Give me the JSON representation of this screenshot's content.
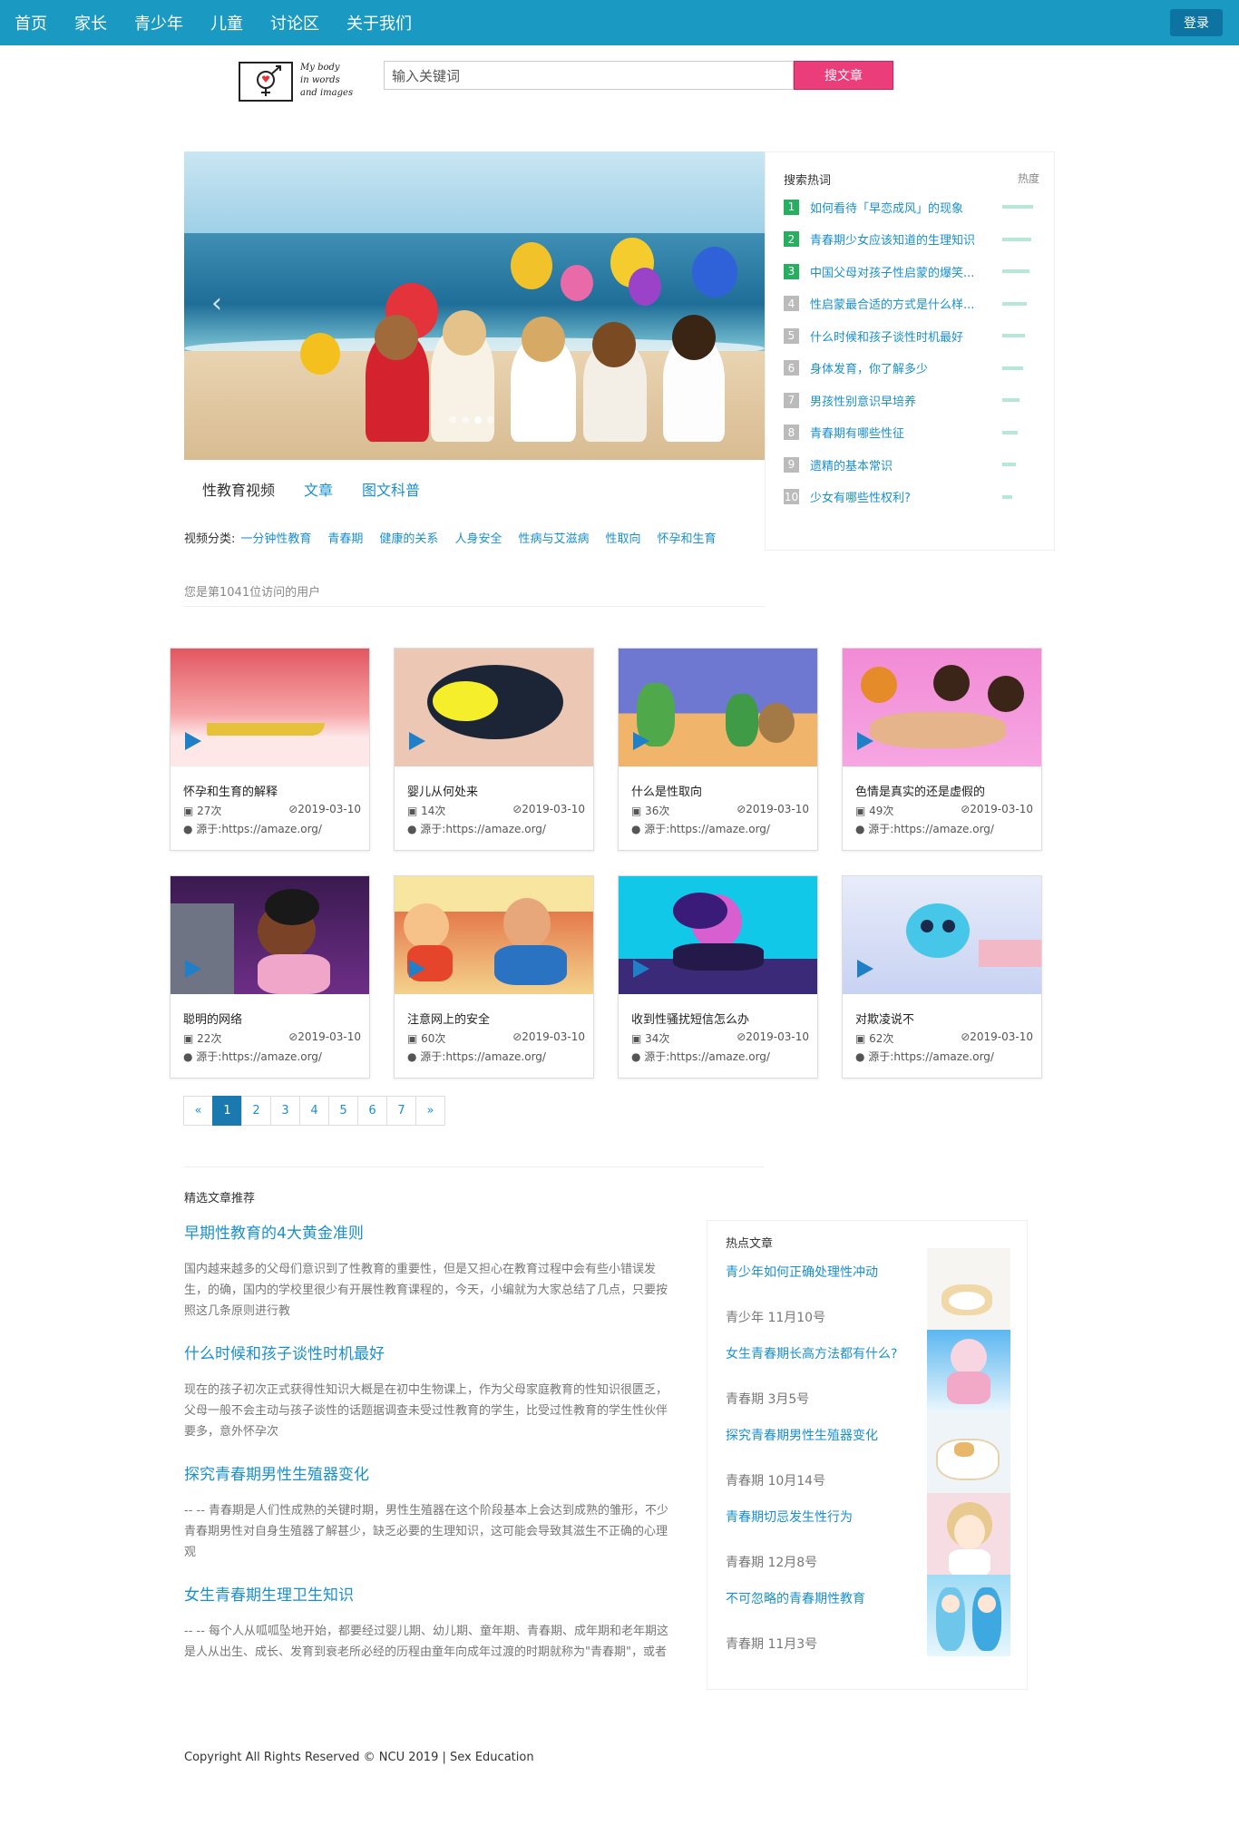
{
  "nav": {
    "links": [
      "首页",
      "家长",
      "青少年",
      "儿童",
      "讨论区",
      "关于我们"
    ],
    "login": "登录"
  },
  "logo": {
    "line1": "My body",
    "line2": "in words",
    "line3": "and images"
  },
  "search": {
    "placeholder": "输入关键词",
    "button": "搜文章"
  },
  "hot_search": {
    "title": "搜索热词",
    "heat_label": "热度",
    "items": [
      {
        "rank": "1",
        "label": "如何看待「早恋成风」的现象",
        "heat": 0.9
      },
      {
        "rank": "2",
        "label": "青春期少女应该知道的生理知识",
        "heat": 0.85
      },
      {
        "rank": "3",
        "label": "中国父母对孩子性启蒙的爆笑...",
        "heat": 0.8
      },
      {
        "rank": "4",
        "label": "性启蒙最合适的方式是什么样...",
        "heat": 0.7
      },
      {
        "rank": "5",
        "label": "什么时候和孩子谈性时机最好",
        "heat": 0.65
      },
      {
        "rank": "6",
        "label": "身体发育，你了解多少",
        "heat": 0.6
      },
      {
        "rank": "7",
        "label": "男孩性别意识早培养",
        "heat": 0.5
      },
      {
        "rank": "8",
        "label": "青春期有哪些性征",
        "heat": 0.45
      },
      {
        "rank": "9",
        "label": "遗精的基本常识",
        "heat": 0.4
      },
      {
        "rank": "10",
        "label": "少女有哪些性权利?",
        "heat": 0.3
      }
    ]
  },
  "tabs": [
    "性教育视频",
    "文章",
    "图文科普"
  ],
  "video_categories": {
    "label": "视频分类:",
    "items": [
      "一分钟性教育",
      "青春期",
      "健康的关系",
      "人身安全",
      "性病与艾滋病",
      "性取向",
      "怀孕和生育"
    ]
  },
  "visitor_text": "您是第1041位访问的用户",
  "videos": [
    {
      "title": "怀孕和生育的解释",
      "views": "27次",
      "date": "⊘2019-03-10",
      "source": "源于:https://amaze.org/"
    },
    {
      "title": "婴儿从何处来",
      "views": "14次",
      "date": "⊘2019-03-10",
      "source": "源于:https://amaze.org/"
    },
    {
      "title": "什么是性取向",
      "views": "36次",
      "date": "⊘2019-03-10",
      "source": "源于:https://amaze.org/"
    },
    {
      "title": "色情是真实的还是虚假的",
      "views": "49次",
      "date": "⊘2019-03-10",
      "source": "源于:https://amaze.org/"
    },
    {
      "title": "聪明的网络",
      "views": "22次",
      "date": "⊘2019-03-10",
      "source": "源于:https://amaze.org/"
    },
    {
      "title": "注意网上的安全",
      "views": "60次",
      "date": "⊘2019-03-10",
      "source": "源于:https://amaze.org/"
    },
    {
      "title": "收到性骚扰短信怎么办",
      "views": "34次",
      "date": "⊘2019-03-10",
      "source": "源于:https://amaze.org/"
    },
    {
      "title": "对欺凌说不",
      "views": "62次",
      "date": "⊘2019-03-10",
      "source": "源于:https://amaze.org/"
    }
  ],
  "pagination": [
    "«",
    "1",
    "2",
    "3",
    "4",
    "5",
    "6",
    "7",
    "»"
  ],
  "featured": {
    "title": "精选文章推荐",
    "articles": [
      {
        "title": "早期性教育的4大黄金准则",
        "body": "国内越来越多的父母们意识到了性教育的重要性，但是又担心在教育过程中会有些小错误发生，的确，国内的学校里很少有开展性教育课程的，今天，小编就为大家总结了几点，只要按照这几条原则进行教"
      },
      {
        "title": "什么时候和孩子谈性时机最好",
        "body": "现在的孩子初次正式获得性知识大概是在初中生物课上，作为父母家庭教育的性知识很匮乏，父母一般不会主动与孩子谈性的话题据调查未受过性教育的学生，比受过性教育的学生性伙伴要多，意外怀孕次"
      },
      {
        "title": "探究青春期男性生殖器变化",
        "body": "-- -- 青春期是人们性成熟的关键时期，男性生殖器在这个阶段基本上会达到成熟的雏形，不少青春期男性对自身生殖器了解甚少，缺乏必要的生理知识，这可能会导致其滋生不正确的心理观"
      },
      {
        "title": "女生青春期生理卫生知识",
        "body": "-- -- 每个人从呱呱坠地开始，都要经过婴儿期、幼儿期、童年期、青春期、成年期和老年期这是人从出生、成长、发育到衰老所必经的历程由童年向成年过渡的时期就称为\"青春期\"，或者"
      }
    ]
  },
  "hot_articles": {
    "title": "热点文章",
    "items": [
      {
        "title": "青少年如何正确处理性冲动",
        "meta": "青少年 11月10号"
      },
      {
        "title": "女生青春期长高方法都有什么?",
        "meta": "青春期 3月5号"
      },
      {
        "title": "探究青春期男性生殖器变化",
        "meta": "青春期 10月14号"
      },
      {
        "title": "青春期切忌发生性行为",
        "meta": "青春期 12月8号"
      },
      {
        "title": "不可忽略的青春期性教育",
        "meta": "青春期 11月3号"
      }
    ]
  },
  "footer": "Copyright All Rights Reserved © NCU 2019 | Sex Education"
}
